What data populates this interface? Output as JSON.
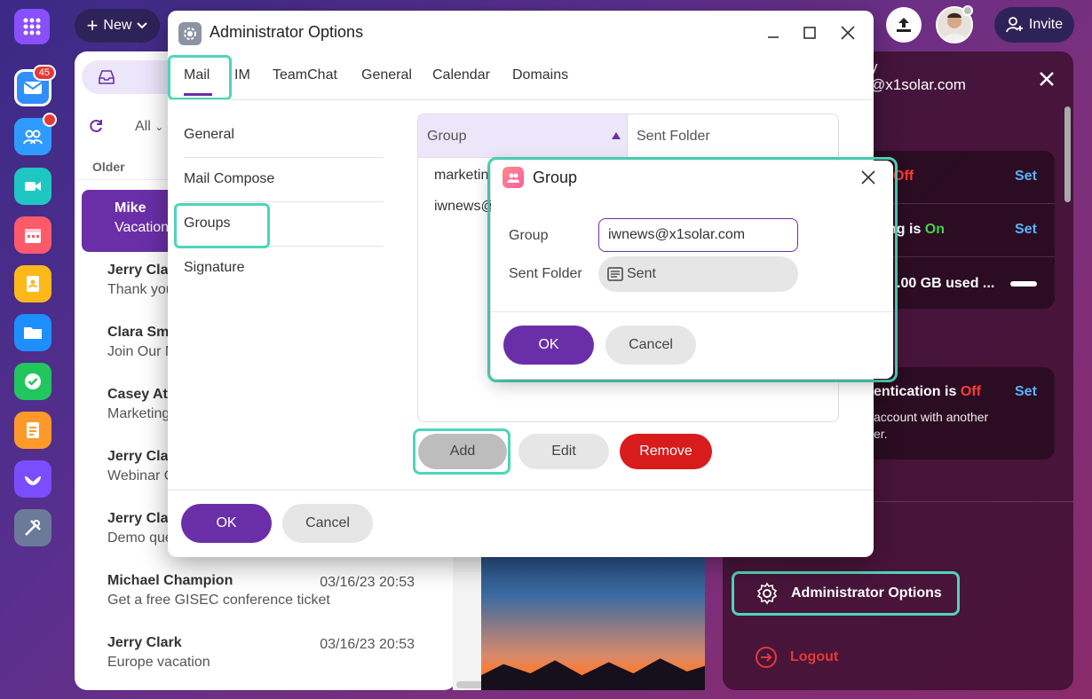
{
  "topbar": {
    "new_label": "New",
    "invite_label": "Invite"
  },
  "rail": {
    "mail_badge": "45"
  },
  "mail_list": {
    "filter_label": "All",
    "section_label": "Older",
    "rows": [
      {
        "name": "Mike",
        "subject": "Vacation",
        "date": ""
      },
      {
        "name": "Jerry Clar",
        "subject": "Thank you",
        "date": ""
      },
      {
        "name": "Clara Smi",
        "subject": "Join Our N",
        "date": ""
      },
      {
        "name": "Casey Atv",
        "subject": "Marketing",
        "date": ""
      },
      {
        "name": "Jerry Clar",
        "subject": "Webinar C",
        "date": ""
      },
      {
        "name": "Jerry Clar",
        "subject": "Demo que",
        "date": ""
      },
      {
        "name": "Michael Champion",
        "subject": "Get a free GISEC conference ticket",
        "date": "03/16/23 20:53"
      },
      {
        "name": "Jerry Clark",
        "subject": "Europe vacation",
        "date": "03/16/23 20:53"
      }
    ]
  },
  "settings_panel": {
    "title_fragment": "y",
    "email_fragment": "@x1solar.com",
    "row1_text": "Off",
    "row1_set": "Set",
    "row2_text": "ng is",
    "row2_state": "On",
    "row2_set": "Set",
    "row3_text": ".00 GB used ...",
    "card2_text": "entication is",
    "card2_state": "Off",
    "card2_set": "Set",
    "card2_sub1": "account with another",
    "card2_sub2": "er.",
    "admin_options_label": "Administrator Options",
    "logout_label": "Logout"
  },
  "admin_window": {
    "title": "Administrator Options",
    "tabs": [
      "Mail",
      "IM",
      "TeamChat",
      "General",
      "Calendar",
      "Domains"
    ],
    "side_items": [
      "General",
      "Mail Compose",
      "Groups",
      "Signature"
    ],
    "table": {
      "col_group": "Group",
      "col_sent_folder": "Sent Folder",
      "rows": [
        "marketin",
        "iwnews@"
      ]
    },
    "buttons": {
      "add": "Add",
      "edit": "Edit",
      "remove": "Remove",
      "ok": "OK",
      "cancel": "Cancel"
    }
  },
  "group_dialog": {
    "title": "Group",
    "group_label": "Group",
    "group_value": "iwnews@x1solar.com",
    "sent_folder_label": "Sent Folder",
    "sent_folder_value": "Sent",
    "ok": "OK",
    "cancel": "Cancel"
  },
  "colors": {
    "accent": "#6a2fa8",
    "highlight": "#4dd6b8",
    "danger": "#d81b1b",
    "link": "#56b4ff"
  }
}
